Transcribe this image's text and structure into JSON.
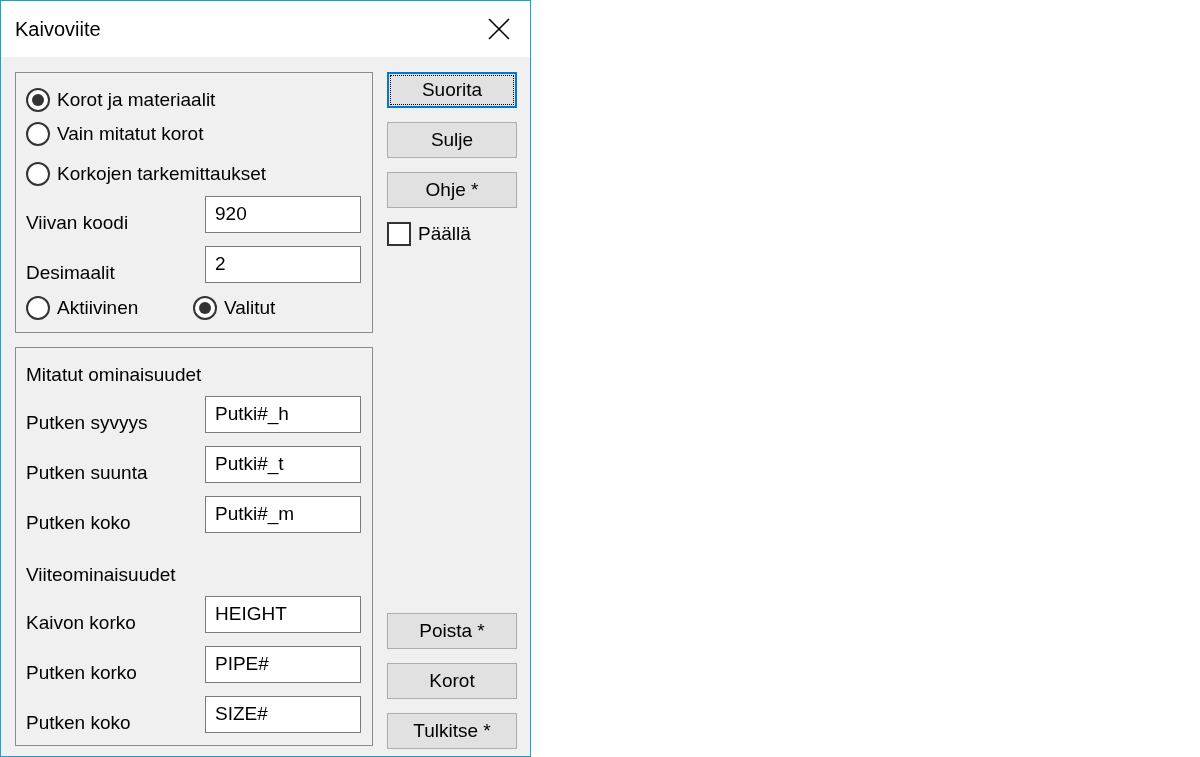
{
  "window": {
    "title": "Kaivoviite"
  },
  "mode_options": [
    {
      "label": "Korot ja materiaalit",
      "selected": true
    },
    {
      "label": "Vain mitatut korot",
      "selected": false
    },
    {
      "label": "Korkojen tarkemittaukset",
      "selected": false
    }
  ],
  "settings": [
    {
      "label": "Viivan koodi",
      "value": "920"
    },
    {
      "label": "Desimaalit",
      "value": "2"
    }
  ],
  "scope_options": [
    {
      "label": "Aktiivinen",
      "selected": false
    },
    {
      "label": "Valitut",
      "selected": true
    }
  ],
  "sections": [
    {
      "heading": "Mitatut ominaisuudet",
      "fields": [
        {
          "label": "Putken syvyys",
          "value": "Putki#_h"
        },
        {
          "label": "Putken suunta",
          "value": "Putki#_t"
        },
        {
          "label": "Putken koko",
          "value": "Putki#_m"
        }
      ]
    },
    {
      "heading": "Viiteominaisuudet",
      "fields": [
        {
          "label": "Kaivon korko",
          "value": "HEIGHT"
        },
        {
          "label": "Putken korko",
          "value": "PIPE#"
        },
        {
          "label": "Putken koko",
          "value": "SIZE#"
        }
      ]
    }
  ],
  "top_buttons": [
    {
      "label": "Suorita",
      "focused": true
    },
    {
      "label": "Sulje",
      "focused": false
    },
    {
      "label": "Ohje *",
      "focused": false
    }
  ],
  "toggle": {
    "label": "Päällä",
    "checked": false
  },
  "bottom_buttons": [
    {
      "label": "Poista *"
    },
    {
      "label": "Korot"
    },
    {
      "label": "Tulkitse *"
    }
  ]
}
